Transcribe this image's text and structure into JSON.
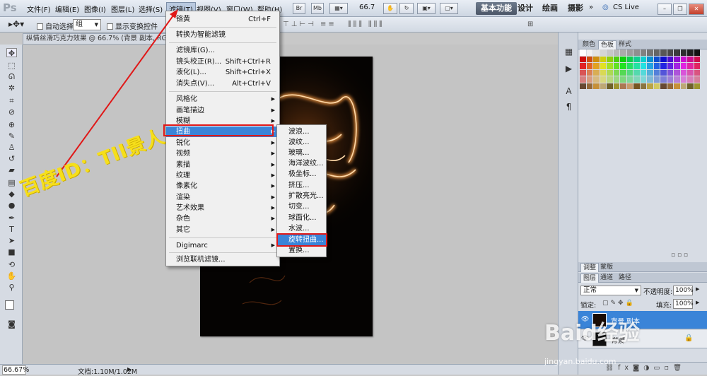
{
  "menubar": {
    "logo": "Ps",
    "items": [
      "文件(F)",
      "编辑(E)",
      "图像(I)",
      "图层(L)",
      "选择(S)",
      "滤镜(T)",
      "视图(V)",
      "窗口(W)",
      "帮助(H)"
    ],
    "br_label": "Br",
    "mb_label": "Mb",
    "zoom": "66.7",
    "workspaces": [
      "基本功能",
      "设计",
      "绘画",
      "摄影"
    ],
    "cslive": "CS Live"
  },
  "options": {
    "auto_select": "自动选择:",
    "group_value": "组",
    "transform_controls": "显示变换控件"
  },
  "document": {
    "tab_title": "纵情丝滑巧克力效果 @ 66.7% (背景 副本, RGB/8"
  },
  "filter_menu": {
    "last_filter": "铬黄",
    "last_filter_shortcut": "Ctrl+F",
    "convert_smart": "转换为智能滤镜",
    "gallery": "滤镜库(G)...",
    "lens": "镜头校正(R)...",
    "lens_shortcut": "Shift+Ctrl+R",
    "liquify": "液化(L)...",
    "liquify_shortcut": "Shift+Ctrl+X",
    "vanish": "消失点(V)...",
    "vanish_shortcut": "Alt+Ctrl+V",
    "groups": [
      "风格化",
      "画笔描边",
      "模糊",
      "扭曲",
      "锐化",
      "视频",
      "素描",
      "纹理",
      "像素化",
      "渲染",
      "艺术效果",
      "杂色",
      "其它"
    ],
    "digimarc": "Digimarc",
    "browse": "浏览联机滤镜..."
  },
  "distort_submenu": {
    "items": [
      "波浪...",
      "波纹...",
      "玻璃...",
      "海洋波纹...",
      "极坐标...",
      "挤压...",
      "扩散亮光...",
      "切变...",
      "球面化...",
      "水波...",
      "旋转扭曲...",
      "置换..."
    ]
  },
  "panels": {
    "color_tabs": [
      "颜色",
      "色板",
      "样式"
    ],
    "adjust_tabs": [
      "调整",
      "蒙版"
    ],
    "layers_tabs": [
      "图层",
      "通道",
      "路径"
    ],
    "blend_mode": "正常",
    "opacity_label": "不透明度:",
    "opacity_value": "100%",
    "lock_label": "锁定:",
    "fill_label": "填充:",
    "fill_value": "100%",
    "layers": [
      "背景 副本",
      "背景"
    ]
  },
  "status": {
    "zoom": "66.67%",
    "doc_info": "文档:1.10M/1.02M"
  },
  "annotations": {
    "watermark": "百度ID：TII景人",
    "baidu_logo": "Baid经验",
    "baidu_url": "jingyan.baidu.com"
  },
  "colors": {
    "highlight": "#3a84d8",
    "red_box": "#e01818",
    "watermark": "#f6df1a"
  }
}
